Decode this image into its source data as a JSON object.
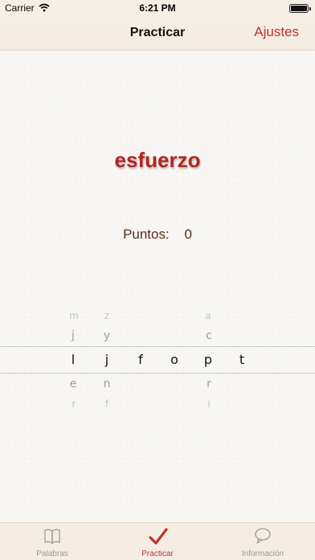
{
  "status": {
    "carrier": "Carrier",
    "time": "6:21 PM"
  },
  "nav": {
    "title": "Practicar",
    "action": "Ajustes"
  },
  "word": "esfuerzo",
  "score": {
    "label": "Puntos:",
    "value": "0"
  },
  "letters": {
    "row0": [
      "m",
      "z",
      "",
      "",
      "a",
      ""
    ],
    "row1": [
      "j",
      "y",
      "",
      "",
      "c",
      ""
    ],
    "row2": [
      "l",
      "j",
      "f",
      "o",
      "p",
      "t"
    ],
    "row3": [
      "e",
      "n",
      "",
      "",
      "r",
      ""
    ],
    "row4": [
      "r",
      "f",
      "",
      "",
      "i",
      ""
    ]
  },
  "tabs": [
    {
      "label": "Palabras",
      "icon": "book-icon",
      "active": false
    },
    {
      "label": "Practicar",
      "icon": "checkmark-icon",
      "active": true
    },
    {
      "label": "Información",
      "icon": "speech-bubble-icon",
      "active": false
    }
  ],
  "colors": {
    "accent": "#c2322a",
    "word": "#b3261e",
    "score": "#5a2c10",
    "bar": "#f6efe6"
  }
}
